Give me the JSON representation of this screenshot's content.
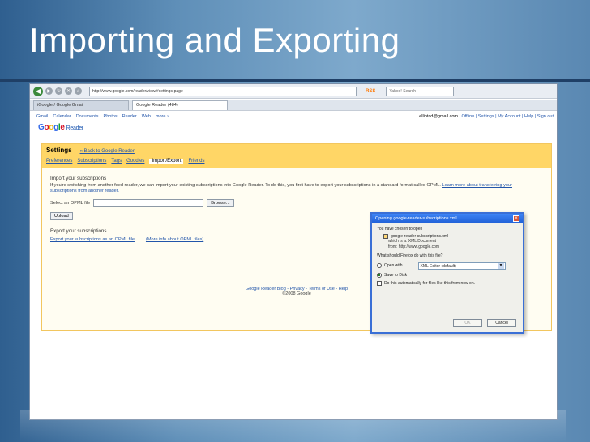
{
  "slide": {
    "title": "Importing and Exporting"
  },
  "browser": {
    "url": "http://www.google.com/reader/view/#settings-page",
    "rss": "RSS",
    "search_placeholder": "Yahoo! Search",
    "tabs": [
      {
        "label": "iGoogle / Google Gmail"
      },
      {
        "label": "Google Reader (484)"
      }
    ],
    "google_links": [
      "Gmail",
      "Calendar",
      "Documents",
      "Photos",
      "Reader",
      "Web",
      "more »"
    ],
    "account_email": "elliotcd@gmail.com",
    "account_links": "| Offline | Settings | My Account | Help | Sign out"
  },
  "logo": {
    "google": "Google",
    "reader": "Reader"
  },
  "settings": {
    "title": "Settings",
    "back": "« Back to Google Reader",
    "tabs": [
      "Preferences",
      "Subscriptions",
      "Tags",
      "Goodies",
      "Import/Export",
      "Friends"
    ],
    "active_tab": "Import/Export",
    "import_heading": "Import your subscriptions",
    "import_desc": "If you're switching from another feed reader, we can import your existing subscriptions into Google Reader. To do this, you first have to export your subscriptions in a standard format called OPML.",
    "import_more": "Learn more about transferring your subscriptions from another reader.",
    "file_label": "Select an OPML file",
    "browse_label": "Browse...",
    "upload_label": "Upload",
    "export_heading": "Export your subscriptions",
    "export_link": "Export your subscriptions as an OPML file",
    "export_more": "(More info about OPML files)"
  },
  "footer": {
    "links": "Google Reader Blog - Privacy - Terms of Use - Help",
    "copyright": "©2008 Google"
  },
  "dialog": {
    "title": "Opening google-reader-subscriptions.xml",
    "intro": "You have chosen to open",
    "filename": "google-reader-subscriptions.xml",
    "which_is": "which is a: XML Document",
    "from": "from: http://www.google.com",
    "question": "What should Firefox do with this file?",
    "open_with": "Open with",
    "app": "XML Editor (default)",
    "save": "Save to Disk",
    "auto": "Do this automatically for files like this from now on.",
    "ok": "OK",
    "cancel": "Cancel"
  }
}
